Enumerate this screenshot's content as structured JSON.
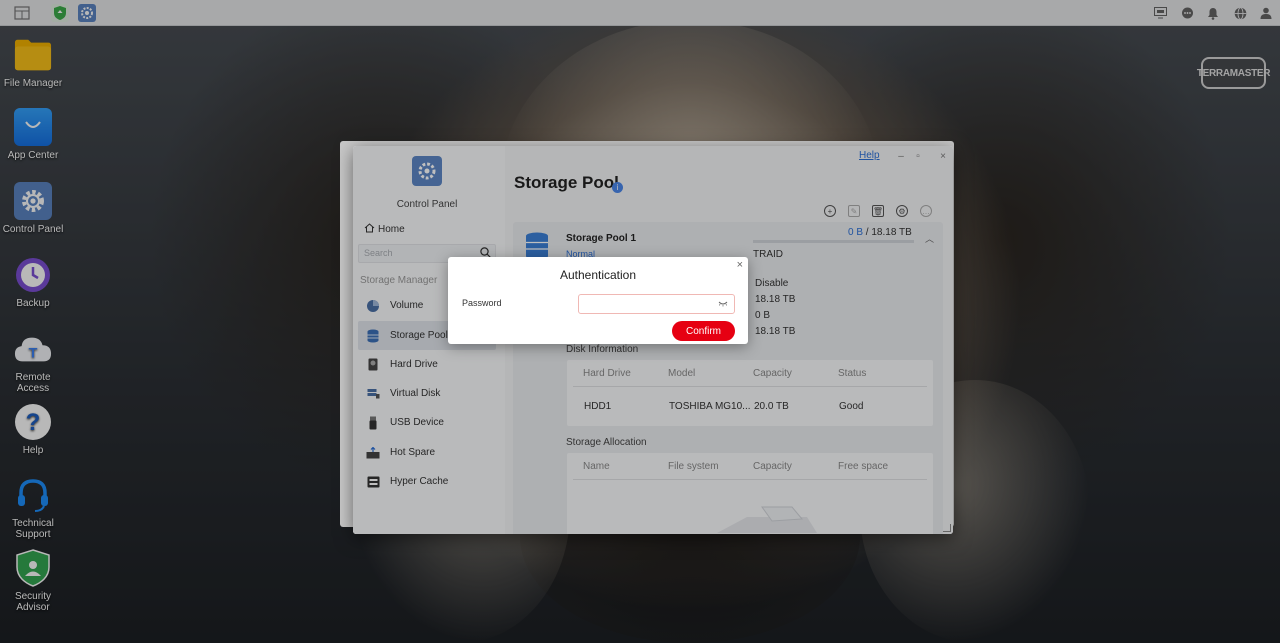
{
  "taskbar": {
    "left_icons": [
      "window-switcher-icon",
      "security-shield-icon",
      "control-panel-icon"
    ],
    "right_icons": [
      "monitor-icon",
      "chat-icon",
      "bell-icon",
      "globe-icon",
      "user-icon"
    ]
  },
  "desktop": {
    "brand": "TERRAMASTER",
    "icons": [
      {
        "label": "File Manager",
        "icon": "folder-icon"
      },
      {
        "label": "App Center",
        "icon": "shopping-bag-icon"
      },
      {
        "label": "Control Panel",
        "icon": "gear-icon"
      },
      {
        "label": "Backup",
        "icon": "clock-icon"
      },
      {
        "label": "Remote Access",
        "icon": "cloud-icon"
      },
      {
        "label": "Help",
        "icon": "question-icon"
      },
      {
        "label": "Technical Support",
        "icon": "headset-icon"
      },
      {
        "label": "Security Advisor",
        "icon": "shield-icon"
      }
    ]
  },
  "window": {
    "app_title": "Control Panel",
    "help_link": "Help",
    "home_label": "Home",
    "search_placeholder": "Search",
    "section_label": "Storage Manager",
    "nav": [
      {
        "label": "Volume",
        "icon": "pie-chart-icon"
      },
      {
        "label": "Storage Pool",
        "icon": "database-icon"
      },
      {
        "label": "Hard Drive",
        "icon": "hard-drive-icon"
      },
      {
        "label": "Virtual Disk",
        "icon": "virtual-disk-icon"
      },
      {
        "label": "USB Device",
        "icon": "usb-icon"
      },
      {
        "label": "Hot Spare",
        "icon": "hot-spare-icon"
      },
      {
        "label": "Hyper Cache",
        "icon": "cache-icon"
      }
    ],
    "page_title": "Storage Pool",
    "pool": {
      "name": "Storage Pool 1",
      "status": "Normal",
      "used": "0 B",
      "separator": "/",
      "total": "18.18 TB",
      "raid": "TRAID",
      "values": [
        "Disable",
        "18.18 TB",
        "0 B",
        "18.18 TB"
      ],
      "disk_info_label": "Disk Information",
      "disk_headers": [
        "Hard Drive",
        "Model",
        "Capacity",
        "Status"
      ],
      "disk_row": [
        "HDD1",
        "TOSHIBA MG10...",
        "20.0 TB",
        "Good"
      ],
      "alloc_label": "Storage Allocation",
      "alloc_headers": [
        "Name",
        "File system",
        "Capacity",
        "Free space"
      ]
    }
  },
  "dialog": {
    "title": "Authentication",
    "close": "×",
    "password_label": "Password",
    "password_value": "",
    "confirm_label": "Confirm"
  },
  "colors": {
    "accent": "#2b6fd6",
    "confirm": "#e60012"
  }
}
